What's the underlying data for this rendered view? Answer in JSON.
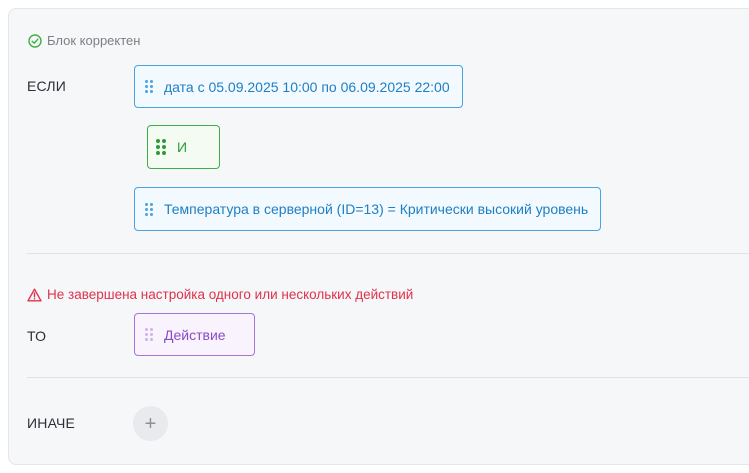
{
  "status_ok": {
    "text": "Блок корректен",
    "icon": "check-circle-icon",
    "color": "#7b8087"
  },
  "if_section": {
    "label": "ЕСЛИ",
    "conditions": [
      {
        "text": "дата с 05.09.2025 10:00 по 06.09.2025 22:00"
      },
      {
        "text": "Температура в серверной (ID=13)  =  Критически высокий уровень"
      }
    ],
    "operator": {
      "text": "И"
    }
  },
  "status_error": {
    "text": "Не завершена настройка одного или нескольких действий",
    "icon": "warning-triangle-icon",
    "color": "#e0324b"
  },
  "then_section": {
    "label": "ТО",
    "action": {
      "text": "Действие"
    }
  },
  "else_section": {
    "label": "ИНАЧЕ",
    "add_symbol": "+"
  },
  "colors": {
    "condition": "#1f7fc4",
    "operator": "#2f9a38",
    "action": "#8a4bc7"
  }
}
